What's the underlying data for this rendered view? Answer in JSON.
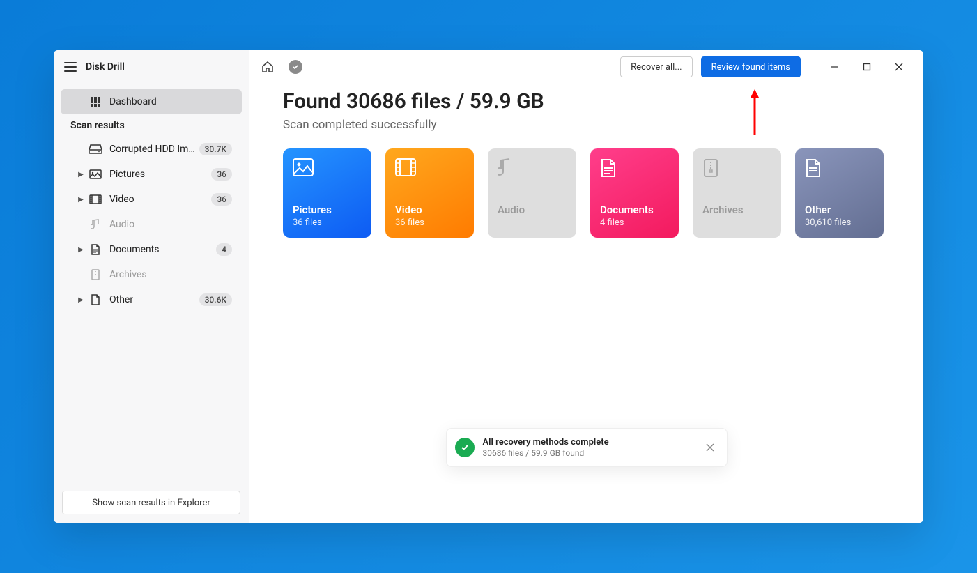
{
  "app": {
    "title": "Disk Drill"
  },
  "sidebar": {
    "dashboard": "Dashboard",
    "section_header": "Scan results",
    "device": {
      "label": "Corrupted HDD Image....",
      "badge": "30.7K"
    },
    "items": [
      {
        "label": "Pictures",
        "badge": "36",
        "has_children": true,
        "muted": false
      },
      {
        "label": "Video",
        "badge": "36",
        "has_children": true,
        "muted": false
      },
      {
        "label": "Audio",
        "badge": "",
        "has_children": false,
        "muted": true
      },
      {
        "label": "Documents",
        "badge": "4",
        "has_children": true,
        "muted": false
      },
      {
        "label": "Archives",
        "badge": "",
        "has_children": false,
        "muted": true
      },
      {
        "label": "Other",
        "badge": "30.6K",
        "has_children": true,
        "muted": false
      }
    ],
    "footer_button": "Show scan results in Explorer"
  },
  "header": {
    "recover_all": "Recover all...",
    "review_button": "Review found items"
  },
  "summary": {
    "headline": "Found 30686 files / 59.9 GB",
    "subhead": "Scan completed successfully"
  },
  "cards": {
    "pictures": {
      "title": "Pictures",
      "count": "36 files"
    },
    "video": {
      "title": "Video",
      "count": "36 files"
    },
    "audio": {
      "title": "Audio",
      "count": "—"
    },
    "documents": {
      "title": "Documents",
      "count": "4 files"
    },
    "archives": {
      "title": "Archives",
      "count": "—"
    },
    "other": {
      "title": "Other",
      "count": "30,610 files"
    }
  },
  "toast": {
    "title": "All recovery methods complete",
    "sub": "30686 files / 59.9 GB found"
  }
}
